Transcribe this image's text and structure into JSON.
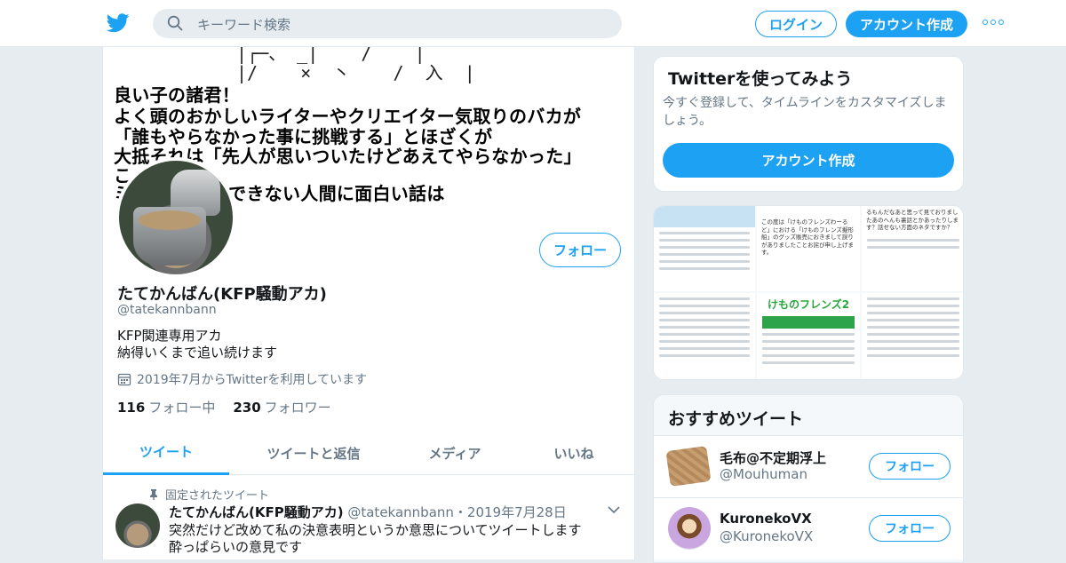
{
  "header": {
    "search_placeholder": "キーワード検索",
    "login_label": "ログイン",
    "signup_label": "アカウント作成",
    "brand_color": "#1da1f2"
  },
  "banner": {
    "ascii_art": "|┌─、 _|    /    |\n|/    ×  丶    /  入  |",
    "lines": [
      "良い子の諸君！",
      "よく頭のおかしいライターやクリエイター気取りのバカが",
      "「誰もやらなかった事に挑戦する」とほざくが",
      "大抵それは「先人が思いついたけどあえてやらなかった」",
      "こ",
      "ミ                       白いか理解できない人間に面白い話は"
    ]
  },
  "profile": {
    "name": "たてかんばん(KFP騒動アカ)",
    "handle": "@tatekannbann",
    "bio_line1": "KFP関連専用アカ",
    "bio_line2": "納得いくまで追い続けます",
    "joined": "2019年7月からTwitterを利用しています",
    "following_count": "116",
    "following_label": "フォロー中",
    "followers_count": "230",
    "followers_label": "フォロワー",
    "follow_label": "フォロー"
  },
  "tabs": [
    {
      "label": "ツイート",
      "active": true
    },
    {
      "label": "ツイートと返信",
      "active": false
    },
    {
      "label": "メディア",
      "active": false
    },
    {
      "label": "いいね",
      "active": false
    }
  ],
  "pinned_tweet": {
    "pinned_label": "固定されたツイート",
    "name": "たてかんばん(KFP騒動アカ)",
    "handle": "@tatekannbann",
    "date": "・2019年7月28日",
    "line1": "突然だけど改めて私の決意表明というか意思についてツイートします",
    "line2": "酔っぱらいの意見です"
  },
  "try_card": {
    "title": "Twitterを使ってみよう",
    "description": "今すぐ登録して、タイムラインをカスタマイズしましょう。",
    "button": "アカウント作成"
  },
  "media_grid": {
    "tile2_text": "この度は「けものフレンズわーるど」における「けものフレンズ擬形船」のグッズ販売におきまして誤りがありましたことお詫び申し上げます。",
    "tile3_text": "るもんだなあと思って見ておりましたあのへんも裏話とかあったりします？話せない方面のネタですか？",
    "tile5_logo": "けものフレンズ2"
  },
  "recommended": {
    "title": "おすすめツイート",
    "users": [
      {
        "name": "毛布@不定期浮上",
        "handle": "@Mouhuman",
        "follow": "フォロー"
      },
      {
        "name": "KuronekoVX",
        "handle": "@KuronekoVX",
        "follow": "フォロー"
      }
    ]
  }
}
